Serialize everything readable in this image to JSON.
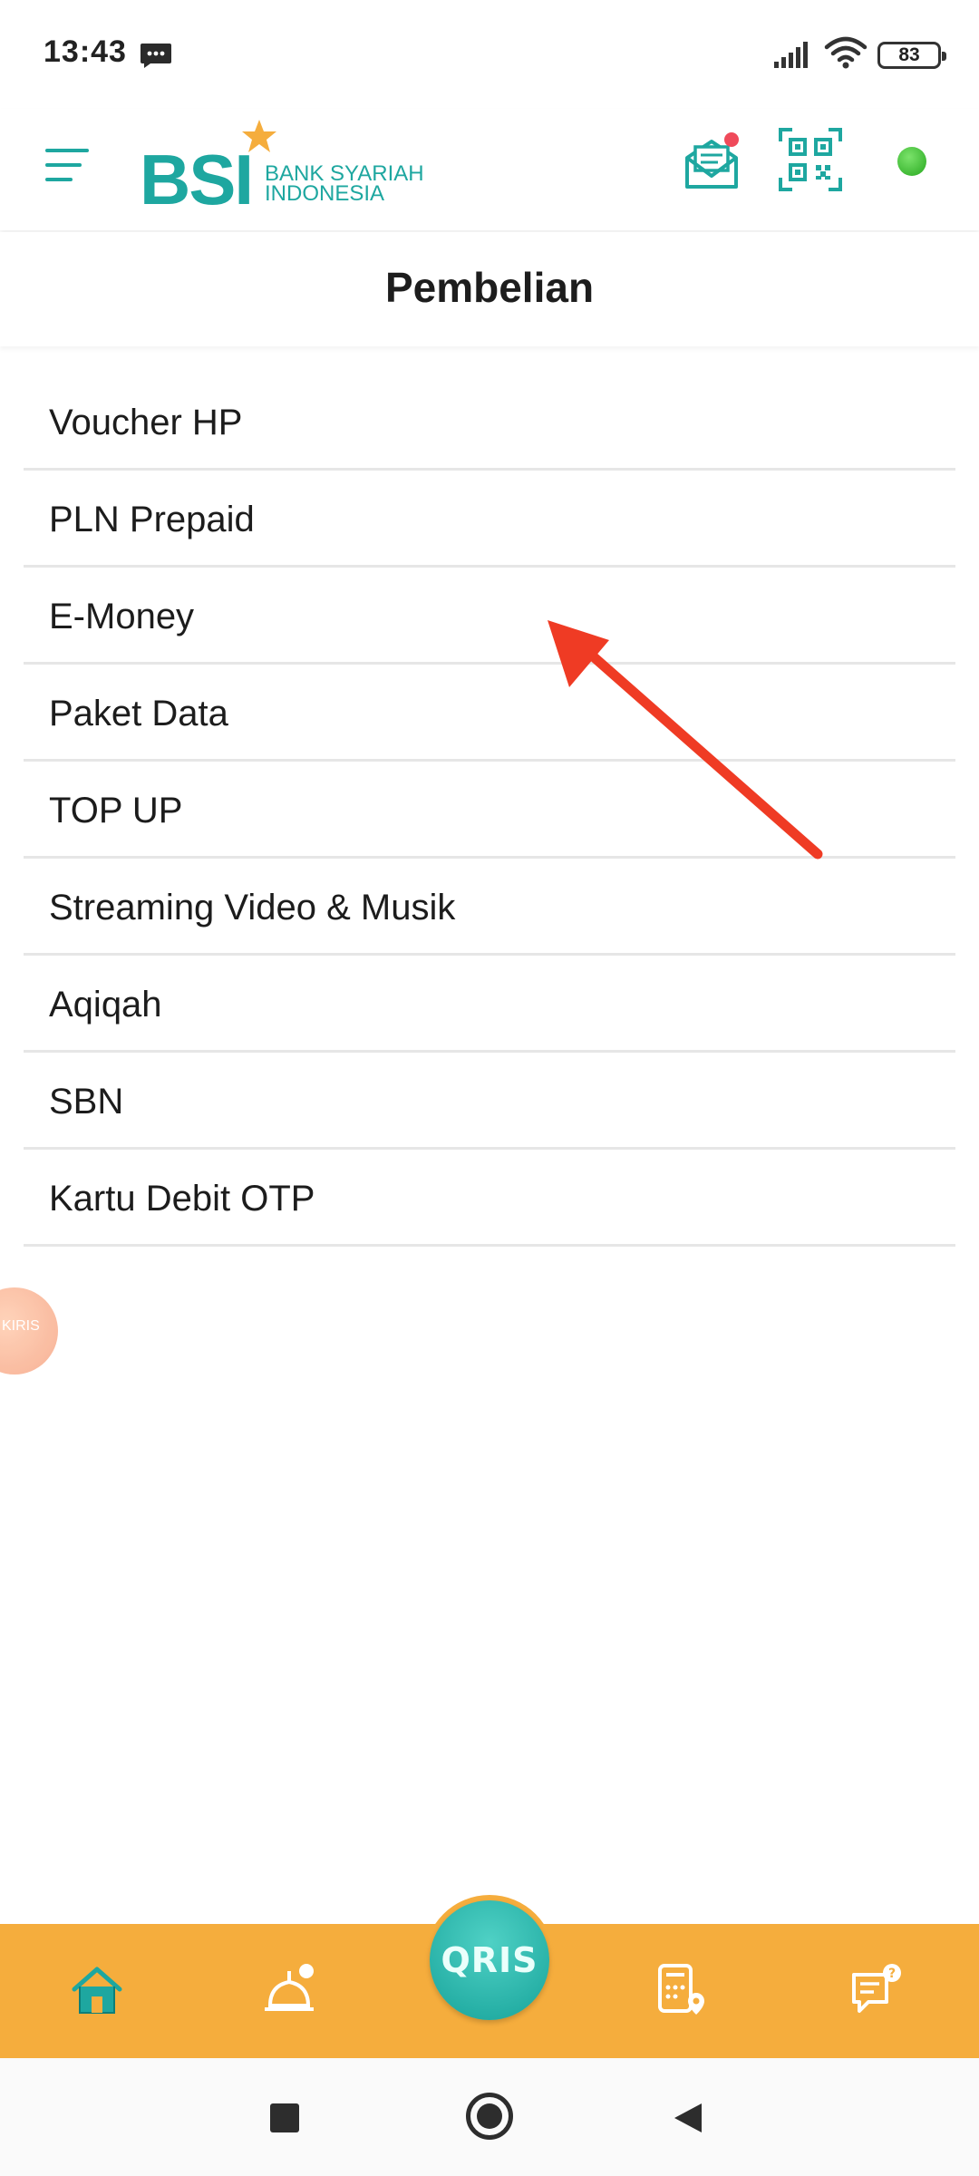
{
  "status_bar": {
    "time": "13:43",
    "battery": "83"
  },
  "header": {
    "logo_main": "BSI",
    "logo_sub_line1": "BANK SYARIAH",
    "logo_sub_line2": "INDONESIA"
  },
  "page": {
    "title": "Pembelian"
  },
  "menu": {
    "items": [
      {
        "label": "Voucher HP"
      },
      {
        "label": "PLN Prepaid"
      },
      {
        "label": "E-Money"
      },
      {
        "label": "Paket Data"
      },
      {
        "label": "TOP UP"
      },
      {
        "label": "Streaming Video & Musik"
      },
      {
        "label": "Aqiqah"
      },
      {
        "label": "SBN"
      },
      {
        "label": "Kartu Debit OTP"
      }
    ]
  },
  "floating": {
    "label": "KIRIS"
  },
  "bottom_nav": {
    "qris_label": "QRIS"
  },
  "colors": {
    "brand_teal": "#1ea7a0",
    "nav_orange": "#f5ad3d",
    "arrow_red": "#ef3b24",
    "online_green": "#3cc02f"
  }
}
